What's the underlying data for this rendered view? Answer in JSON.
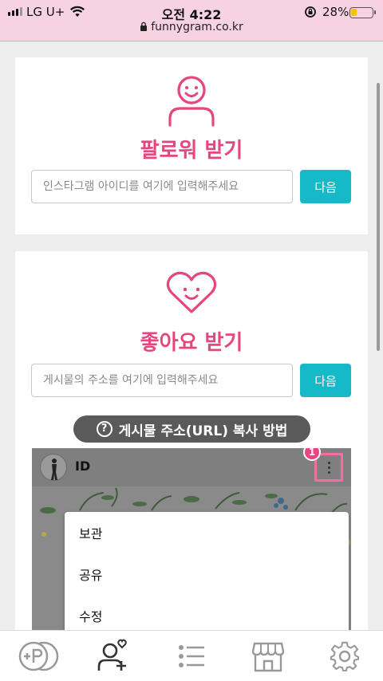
{
  "status_bar": {
    "carrier": "LG U+",
    "time": "오전 4:22",
    "battery_percent": "28%",
    "battery_level": 0.28,
    "url": "funnygram.co.kr"
  },
  "followers_card": {
    "title": "팔로워 받기",
    "input_placeholder": "인스타그램 아이디를 여기에 입력해주세요",
    "next_label": "다음",
    "icon": "person-smile-icon"
  },
  "likes_card": {
    "title": "좋아요 받기",
    "input_placeholder": "게시물의 주소를 여기에 입력해주세요",
    "next_label": "다음",
    "icon": "heart-smile-icon",
    "help_label": "게시물 주소(URL) 복사 방법",
    "tutorial": {
      "username": "ID",
      "badge": "1",
      "menu_items": [
        "보관",
        "공유",
        "수정"
      ]
    }
  },
  "bottom_nav": {
    "items": [
      "plus-p-icon",
      "add-follower-icon",
      "list-icon",
      "store-icon",
      "settings-icon"
    ]
  },
  "colors": {
    "accent_pink": "#e6457e",
    "button_teal": "#16b9c8",
    "status_bar_bg": "#f7d3e2"
  }
}
